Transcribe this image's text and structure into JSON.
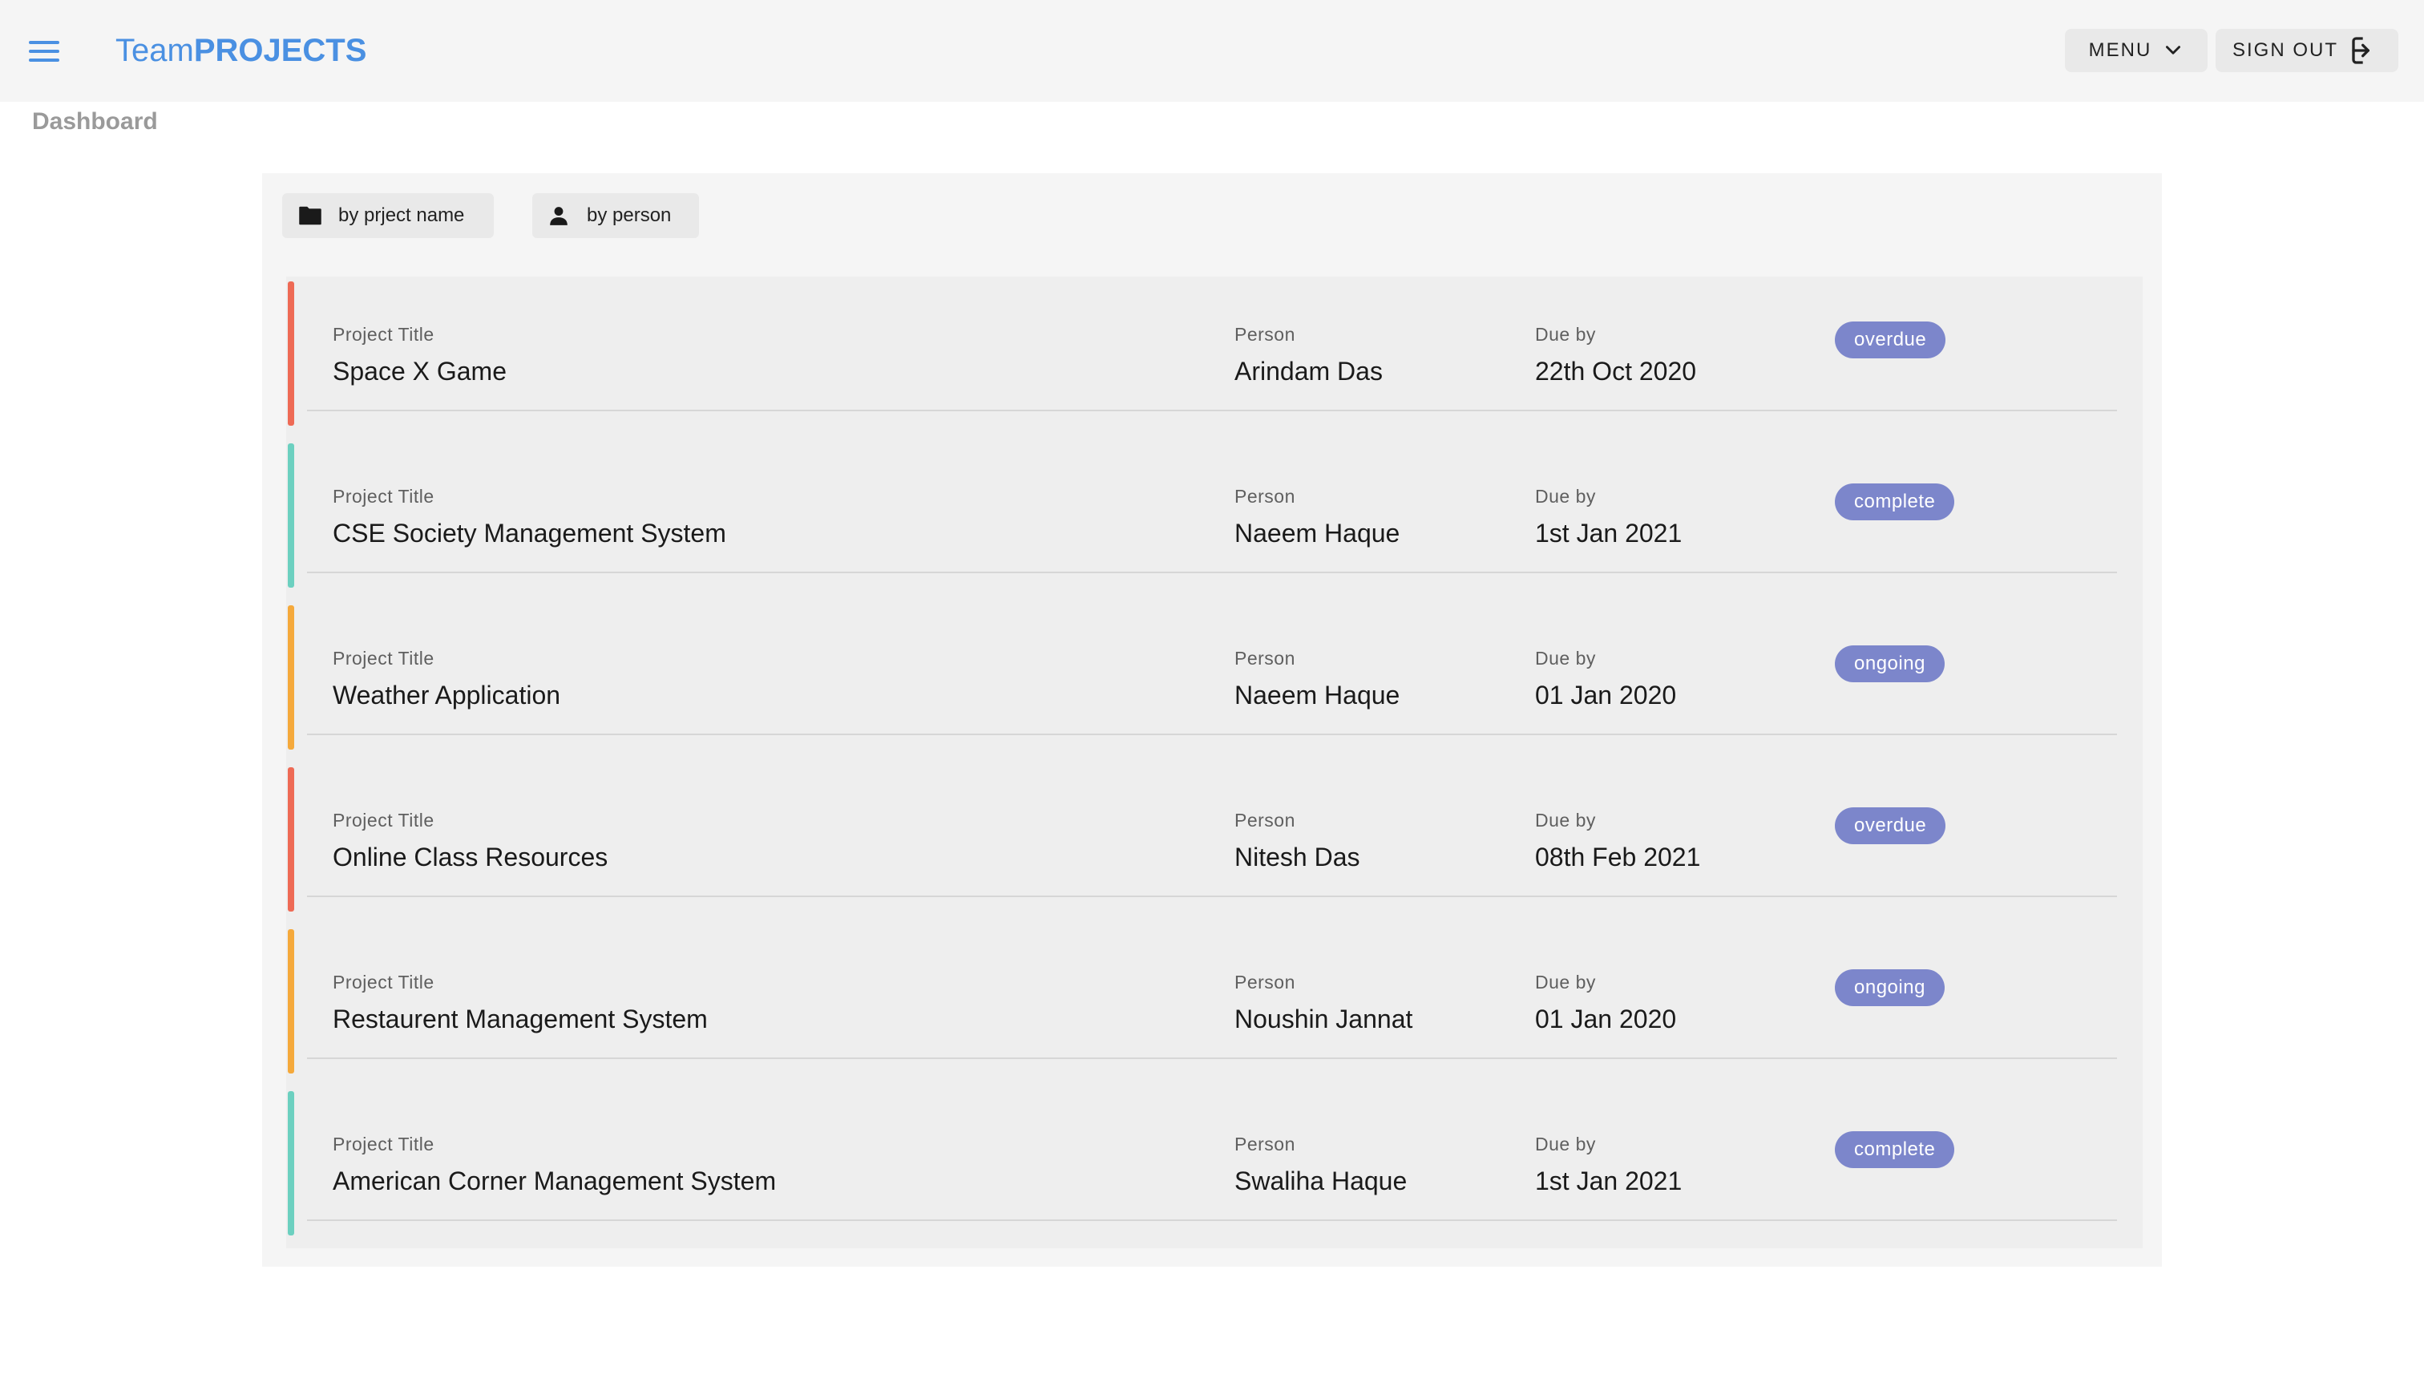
{
  "brand": {
    "light": "Team",
    "bold": "PROJECTS"
  },
  "header": {
    "menu_label": "MENU",
    "signout_label": "SIGN OUT"
  },
  "breadcrumb": "Dashboard",
  "filters": {
    "by_name": "by prject name",
    "by_person": "by person"
  },
  "labels": {
    "title": "Project Title",
    "person": "Person",
    "due": "Due by"
  },
  "colors": {
    "accent": "#4a90e2",
    "badge": "#7c86cb",
    "overdue": "#ee6a55",
    "complete": "#6cd0c0",
    "ongoing": "#f5a93b"
  },
  "projects": [
    {
      "title": "Space X Game",
      "person": "Arindam Das",
      "due": "22th Oct 2020",
      "status": "overdue"
    },
    {
      "title": "CSE Society Management System",
      "person": "Naeem Haque",
      "due": "1st Jan 2021",
      "status": "complete"
    },
    {
      "title": "Weather Application",
      "person": "Naeem Haque",
      "due": "01 Jan 2020",
      "status": "ongoing"
    },
    {
      "title": "Online Class Resources",
      "person": "Nitesh Das",
      "due": "08th Feb 2021",
      "status": "overdue"
    },
    {
      "title": "Restaurent Management System",
      "person": "Noushin Jannat",
      "due": "01 Jan 2020",
      "status": "ongoing"
    },
    {
      "title": "American Corner Management System",
      "person": "Swaliha Haque",
      "due": "1st Jan 2021",
      "status": "complete"
    }
  ]
}
